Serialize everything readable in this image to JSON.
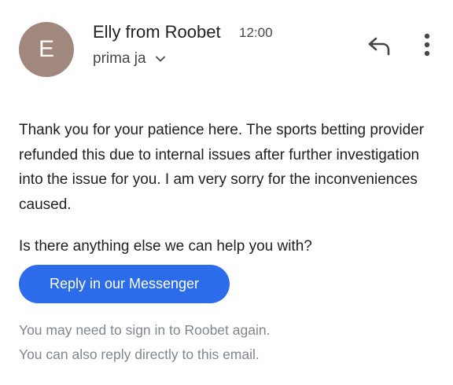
{
  "sender": {
    "avatar_letter": "E",
    "name": "Elly from Roobet",
    "time": "12:00",
    "recipient": "prima ja",
    "avatar_color": "#a1887f"
  },
  "icons": {
    "reply": "reply-icon",
    "more": "more-vert-icon",
    "expand": "chevron-down-icon"
  },
  "message": {
    "body": "Thank you for your patience here. The sports betting provider refunded this due to internal issues after further investigation into the issue for you. I am very sorry for the inconveniences caused.",
    "question": "Is there anything else we can help you with?"
  },
  "cta": {
    "label": "Reply in our Messenger",
    "color": "#2c6be9"
  },
  "footer": {
    "line1": "You may need to sign in to Roobet again.",
    "line2": "You can also reply directly to this email."
  }
}
